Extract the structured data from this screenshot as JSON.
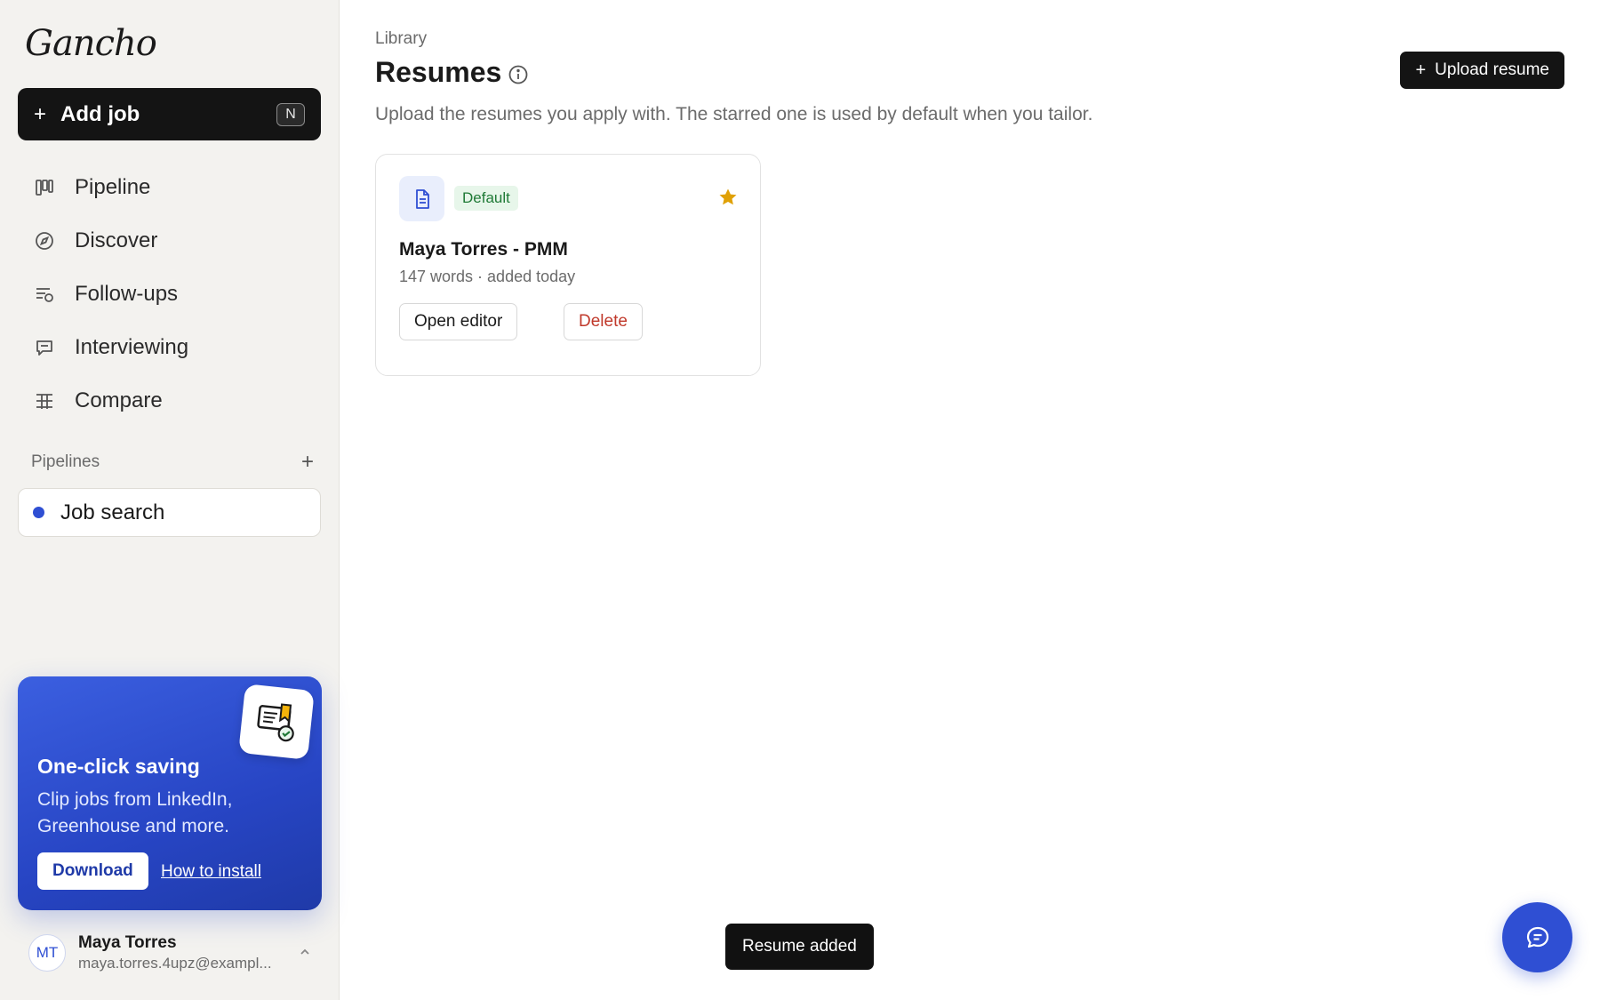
{
  "brand": {
    "logo_text": "Gancho"
  },
  "sidebar": {
    "add_job": {
      "label": "Add job",
      "shortcut": "N"
    },
    "nav": [
      {
        "label": "Pipeline",
        "icon": "kanban-icon"
      },
      {
        "label": "Discover",
        "icon": "compass-icon"
      },
      {
        "label": "Follow-ups",
        "icon": "list-clock-icon"
      },
      {
        "label": "Interviewing",
        "icon": "chat-bubble-icon"
      },
      {
        "label": "Compare",
        "icon": "table-icon"
      }
    ],
    "pipelines_heading": "Pipelines",
    "pipelines": [
      {
        "label": "Job search",
        "color": "#2f4fd3"
      }
    ],
    "promo": {
      "title": "One-click saving",
      "description": "Clip jobs from LinkedIn, Greenhouse and more.",
      "download_label": "Download",
      "howto_label": "How to install"
    },
    "user": {
      "initials": "MT",
      "name": "Maya Torres",
      "email": "maya.torres.4upz@exampl..."
    }
  },
  "main": {
    "breadcrumb": "Library",
    "title": "Resumes",
    "subtitle": "Upload the resumes you apply with. The starred one is used by default when you tailor.",
    "upload_label": "Upload resume",
    "resumes": [
      {
        "badge": "Default",
        "name": "Maya Torres - PMM",
        "meta": "147 words · added today",
        "open_label": "Open editor",
        "delete_label": "Delete",
        "starred": true
      }
    ]
  },
  "toast": {
    "text": "Resume added"
  },
  "colors": {
    "accent": "#2f4fd3",
    "star": "#e0a106",
    "danger": "#c0392b",
    "success": "#1f7a36"
  }
}
